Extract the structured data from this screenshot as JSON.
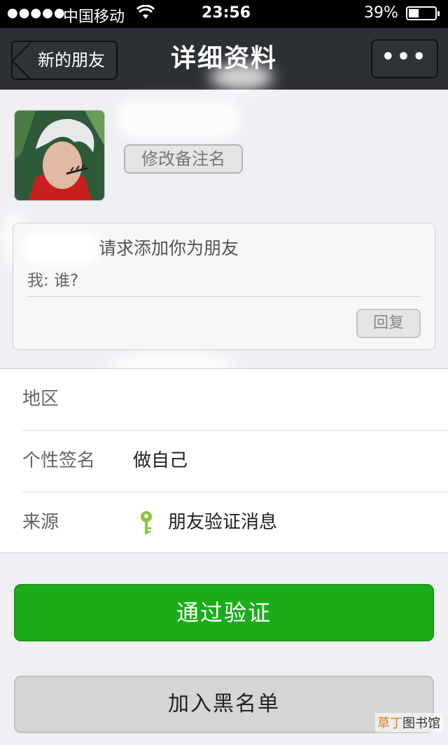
{
  "status_bar": {
    "carrier": "中国移动",
    "time": "23:56",
    "battery_percent": "39%",
    "battery_level": 0.39
  },
  "nav": {
    "back_label": "新的朋友",
    "title": "详细资料",
    "more_label": "•••"
  },
  "profile": {
    "remark_button": "修改备注名"
  },
  "message": {
    "line1": "请求添加你为朋友",
    "line2": "我: 谁?",
    "reply_button": "回复"
  },
  "info": {
    "region_label": "地区",
    "signature_label": "个性签名",
    "signature_value": "做自己",
    "source_label": "来源",
    "source_value": "朋友验证消息"
  },
  "actions": {
    "verify_label": "通过验证",
    "blacklist_label": "加入黑名单"
  },
  "watermark": {
    "accent": "草丁",
    "text": "图书馆"
  },
  "colors": {
    "nav_bg": "#2c3035",
    "accent_green": "#1aad19",
    "key_icon": "#8cc63f"
  }
}
